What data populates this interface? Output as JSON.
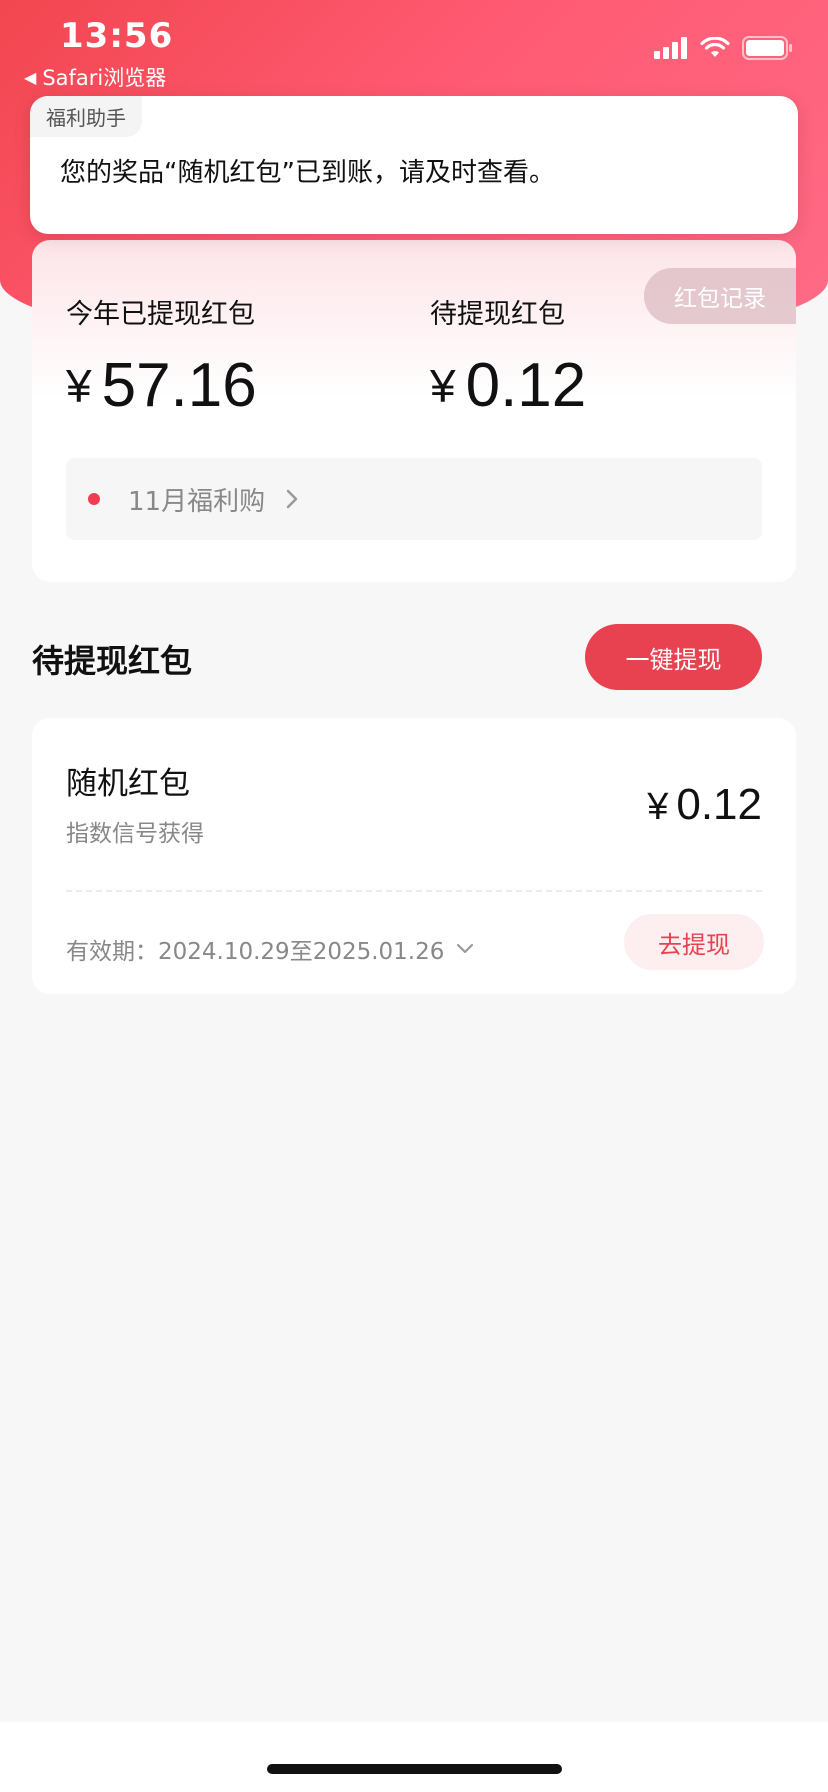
{
  "status_bar": {
    "time": "13:56",
    "back_app": "Safari浏览器"
  },
  "notification": {
    "source": "福利助手",
    "message": "您的奖品“随机红包”已到账，请及时查看。"
  },
  "summary": {
    "record_button": "红包记录",
    "withdrawn_label": "今年已提现红包",
    "withdrawn_currency": "¥",
    "withdrawn_amount": "57.16",
    "pending_label": "待提现红包",
    "pending_currency": "¥",
    "pending_amount": "0.12",
    "promo_text": "11月福利购"
  },
  "section": {
    "title": "待提现红包",
    "withdraw_all_button": "一键提现"
  },
  "envelope": {
    "name": "随机红包",
    "source": "指数信号获得",
    "currency": "¥",
    "amount": "0.12",
    "validity": "有效期：2024.10.29至2025.01.26",
    "withdraw_button": "去提现"
  },
  "colors": {
    "brand_red": "#e8414f",
    "header_gradient_start": "#f2464f",
    "header_gradient_end": "#ff6b86"
  },
  "icons": {
    "back": "back-arrow-icon",
    "signal": "cellular-signal-icon",
    "wifi": "wifi-icon",
    "battery": "battery-icon",
    "promo_chevron": "chevron-right-icon",
    "validity_chevron": "chevron-down-icon"
  }
}
